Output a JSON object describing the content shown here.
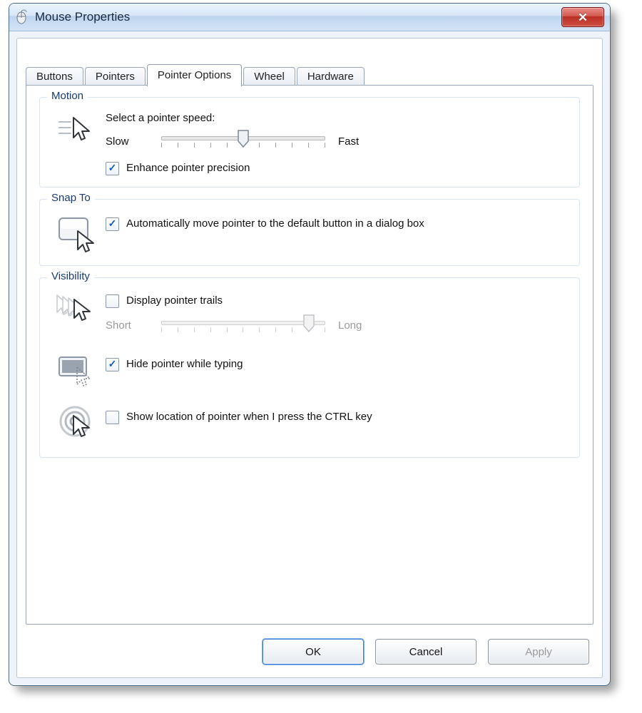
{
  "window": {
    "title": "Mouse Properties"
  },
  "tabs": [
    "Buttons",
    "Pointers",
    "Pointer Options",
    "Wheel",
    "Hardware"
  ],
  "active_tab_index": 2,
  "groups": {
    "motion": {
      "legend": "Motion",
      "speed_label": "Select a pointer speed:",
      "slow": "Slow",
      "fast": "Fast",
      "speed_value": 5,
      "speed_ticks": 11,
      "enhance_label": "Enhance pointer precision",
      "enhance_checked": true
    },
    "snap": {
      "legend": "Snap To",
      "auto_label": "Automatically move pointer to the default button in a dialog box",
      "auto_checked": true
    },
    "visibility": {
      "legend": "Visibility",
      "trails_label": "Display pointer trails",
      "trails_checked": false,
      "short": "Short",
      "long": "Long",
      "trails_value": 9,
      "trails_ticks": 11,
      "trails_enabled": false,
      "hide_label": "Hide pointer while typing",
      "hide_checked": true,
      "ctrl_label": "Show location of pointer when I press the CTRL key",
      "ctrl_checked": false
    }
  },
  "buttons": {
    "ok": "OK",
    "cancel": "Cancel",
    "apply": "Apply",
    "apply_enabled": false
  }
}
